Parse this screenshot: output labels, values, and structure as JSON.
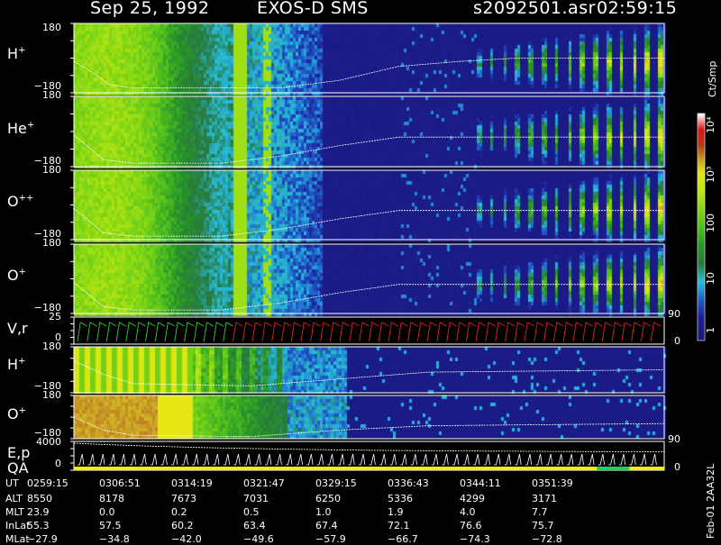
{
  "header": {
    "date": "Sep 25, 1992",
    "mission": "EXOS-D SMS",
    "file": "s2092501.asr",
    "time": "02:59:15"
  },
  "colors": {
    "background": "#000000",
    "axis": "#ffffff",
    "velocity_trace_green": "#30d030",
    "velocity_trace_red": "#e02020",
    "qa_bar": "#f0f000",
    "qa_bar_good": "#20d060"
  },
  "panels": [
    {
      "id": "h_plus",
      "species": "H",
      "charge": "+",
      "ytop": "180",
      "ybot": "−180"
    },
    {
      "id": "he_plus",
      "species": "He",
      "charge": "+",
      "ytop": "180",
      "ybot": "−180"
    },
    {
      "id": "o_plusplus",
      "species": "O",
      "charge": "++",
      "ytop": "180",
      "ybot": "−180"
    },
    {
      "id": "o_plus",
      "species": "O",
      "charge": "+",
      "ytop": "180",
      "ybot": "−180",
      "right_tick": "90"
    },
    {
      "id": "vr",
      "label": "V,r",
      "ytop": "25",
      "ybot": "0",
      "right_tick": "0"
    },
    {
      "id": "h_plus_2",
      "species": "H",
      "charge": "+",
      "ytop": "180",
      "ybot": "−180"
    },
    {
      "id": "o_plus_2",
      "species": "O",
      "charge": "+",
      "ytop": "180",
      "ybot": "−180",
      "right_tick": "90"
    },
    {
      "id": "ep_qa",
      "label1": "E,p",
      "label2": "QA",
      "ytop": "4000",
      "ybot": "0",
      "right_tick": "0"
    }
  ],
  "colorbar": {
    "unit": "Ct/Smp",
    "ticks": [
      {
        "text": "10⁴",
        "rotated": true
      },
      {
        "text": "10³",
        "rotated": true
      },
      {
        "text": "100",
        "rotated": true
      },
      {
        "text": "10",
        "rotated": true
      },
      {
        "text": "1",
        "rotated": true
      }
    ]
  },
  "ephemeris": {
    "rows": [
      {
        "label": "UT",
        "values": [
          "0259:15",
          "0306:51",
          "0314:19",
          "0321:47",
          "0329:15",
          "0336:43",
          "0344:11",
          "0351:39"
        ]
      },
      {
        "label": "ALT",
        "values": [
          "8550",
          "8178",
          "7673",
          "7031",
          "6250",
          "5336",
          "4299",
          "3171"
        ]
      },
      {
        "label": "MLT",
        "values": [
          "23.9",
          "0.0",
          "0.2",
          "0.5",
          "1.0",
          "1.9",
          "4.0",
          "7.7"
        ]
      },
      {
        "label": "InLat",
        "values": [
          "55.3",
          "57.5",
          "60.2",
          "63.4",
          "67.4",
          "72.1",
          "76.6",
          "75.7"
        ]
      },
      {
        "label": "MLat",
        "values": [
          "−27.9",
          "−34.8",
          "−42.0",
          "−49.6",
          "−57.9",
          "−66.7",
          "−74.3",
          "−72.8"
        ]
      }
    ]
  },
  "file_id": "Feb-01 2AA32L",
  "chart_data": {
    "type": "heatmap",
    "title": "Sep 25, 1992   EXOS-D SMS",
    "x": [
      "0259:15",
      "0306:51",
      "0314:19",
      "0321:47",
      "0329:15",
      "0336:43",
      "0344:11",
      "0351:39"
    ],
    "xlabel": "UT",
    "ylim": [
      -180,
      180
    ],
    "colorbar_label": "Ct/Smp",
    "colorbar_scale": "log",
    "colorbar_ticks": [
      "1",
      "10",
      "100",
      "10³",
      "10⁴"
    ],
    "series": [
      {
        "name": "H+"
      },
      {
        "name": "He+"
      },
      {
        "name": "O++"
      },
      {
        "name": "O+"
      },
      {
        "name": "V,r"
      },
      {
        "name": "H+"
      },
      {
        "name": "O+"
      },
      {
        "name": "E,p"
      },
      {
        "name": "QA"
      }
    ]
  }
}
